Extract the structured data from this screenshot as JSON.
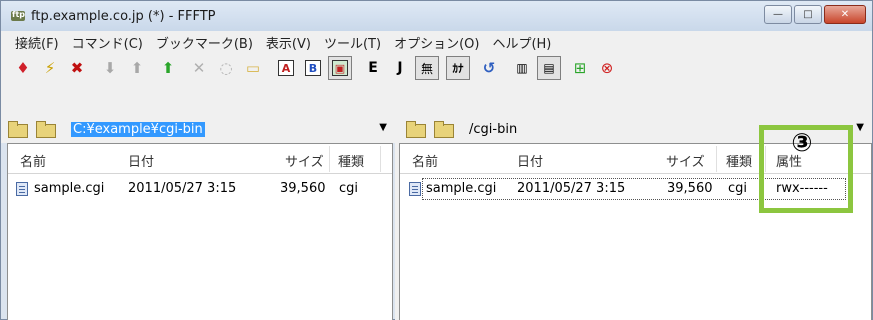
{
  "window": {
    "title": "ftp.example.co.jp (*) - FFFTP",
    "controls": {
      "minimize": "—",
      "maximize": "□",
      "close": "✕"
    }
  },
  "menu": [
    {
      "label": "接続(F)"
    },
    {
      "label": "コマンド(C)"
    },
    {
      "label": "ブックマーク(B)"
    },
    {
      "label": "表示(V)"
    },
    {
      "label": "ツール(T)"
    },
    {
      "label": "オプション(O)"
    },
    {
      "label": "ヘルプ(H)"
    }
  ],
  "toolbar": {
    "icons": [
      "connect-icon",
      "quick-connect-icon",
      "disconnect-icon",
      "download-icon",
      "upload-icon",
      "mirror-upload-icon",
      "delete-icon",
      "rename-icon",
      "mkdir-icon",
      "ascii-mode-icon",
      "binary-mode-icon",
      "auto-mode-icon",
      "euc-icon",
      "jis-icon",
      "no-conversion-icon",
      "kana-icon",
      "refresh-icon",
      "list-view-icon",
      "detail-view-icon",
      "sync-icon",
      "stop-icon"
    ],
    "letters": {
      "ascii": "A",
      "binary": "B",
      "euc": "E",
      "jis": "J",
      "none": "無",
      "kana": "ｶﾅ"
    }
  },
  "local": {
    "path": "C:¥example¥cgi-bin",
    "columns": [
      "名前",
      "日付",
      "サイズ",
      "種類"
    ],
    "files": [
      {
        "name": "sample.cgi",
        "date": "2011/05/27  3:15",
        "size": "39,560",
        "type": "cgi"
      }
    ]
  },
  "remote": {
    "path": "/cgi-bin",
    "columns": [
      "名前",
      "日付",
      "サイズ",
      "種類",
      "属性"
    ],
    "files": [
      {
        "name": "sample.cgi",
        "date": "2011/05/27  3:15",
        "size": "39,560",
        "type": "cgi",
        "attr": "rwx------"
      }
    ]
  },
  "callout": {
    "label": "③",
    "color": "#8cc63f"
  }
}
